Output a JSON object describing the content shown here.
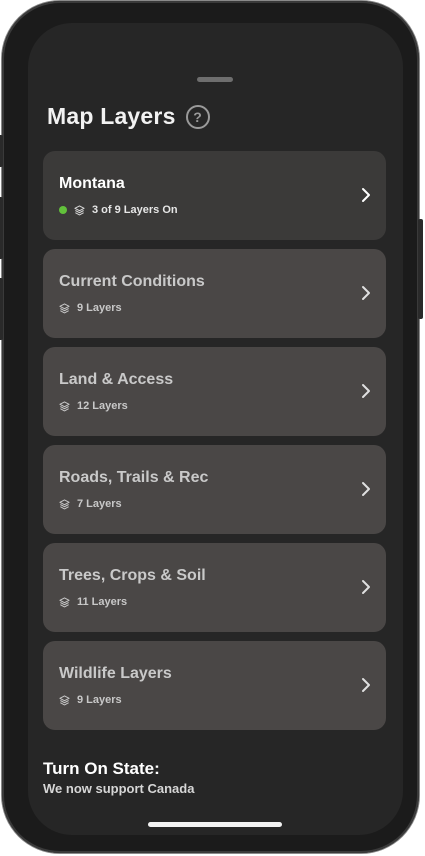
{
  "header": {
    "title": "Map Layers",
    "help_icon": "?"
  },
  "cards": [
    {
      "title": "Montana",
      "meta": "3 of 9 Layers On",
      "active": true,
      "status_color": "#62c13b"
    },
    {
      "title": "Current Conditions",
      "meta": "9 Layers",
      "active": false
    },
    {
      "title": "Land & Access",
      "meta": "12 Layers",
      "active": false
    },
    {
      "title": "Roads, Trails & Rec",
      "meta": "7 Layers",
      "active": false
    },
    {
      "title": "Trees, Crops & Soil",
      "meta": "11 Layers",
      "active": false
    },
    {
      "title": "Wildlife Layers",
      "meta": "9 Layers",
      "active": false
    }
  ],
  "footer": {
    "title": "Turn On State:",
    "subtitle": "We now support Canada"
  },
  "icons": {
    "layers": "layers-icon",
    "chevron": "chevron-right-icon",
    "help": "help-icon",
    "status": "status-dot"
  },
  "colors": {
    "background": "#262626",
    "card": "#4a4746",
    "card_active": "#3b3a39",
    "status_on": "#62c13b"
  }
}
